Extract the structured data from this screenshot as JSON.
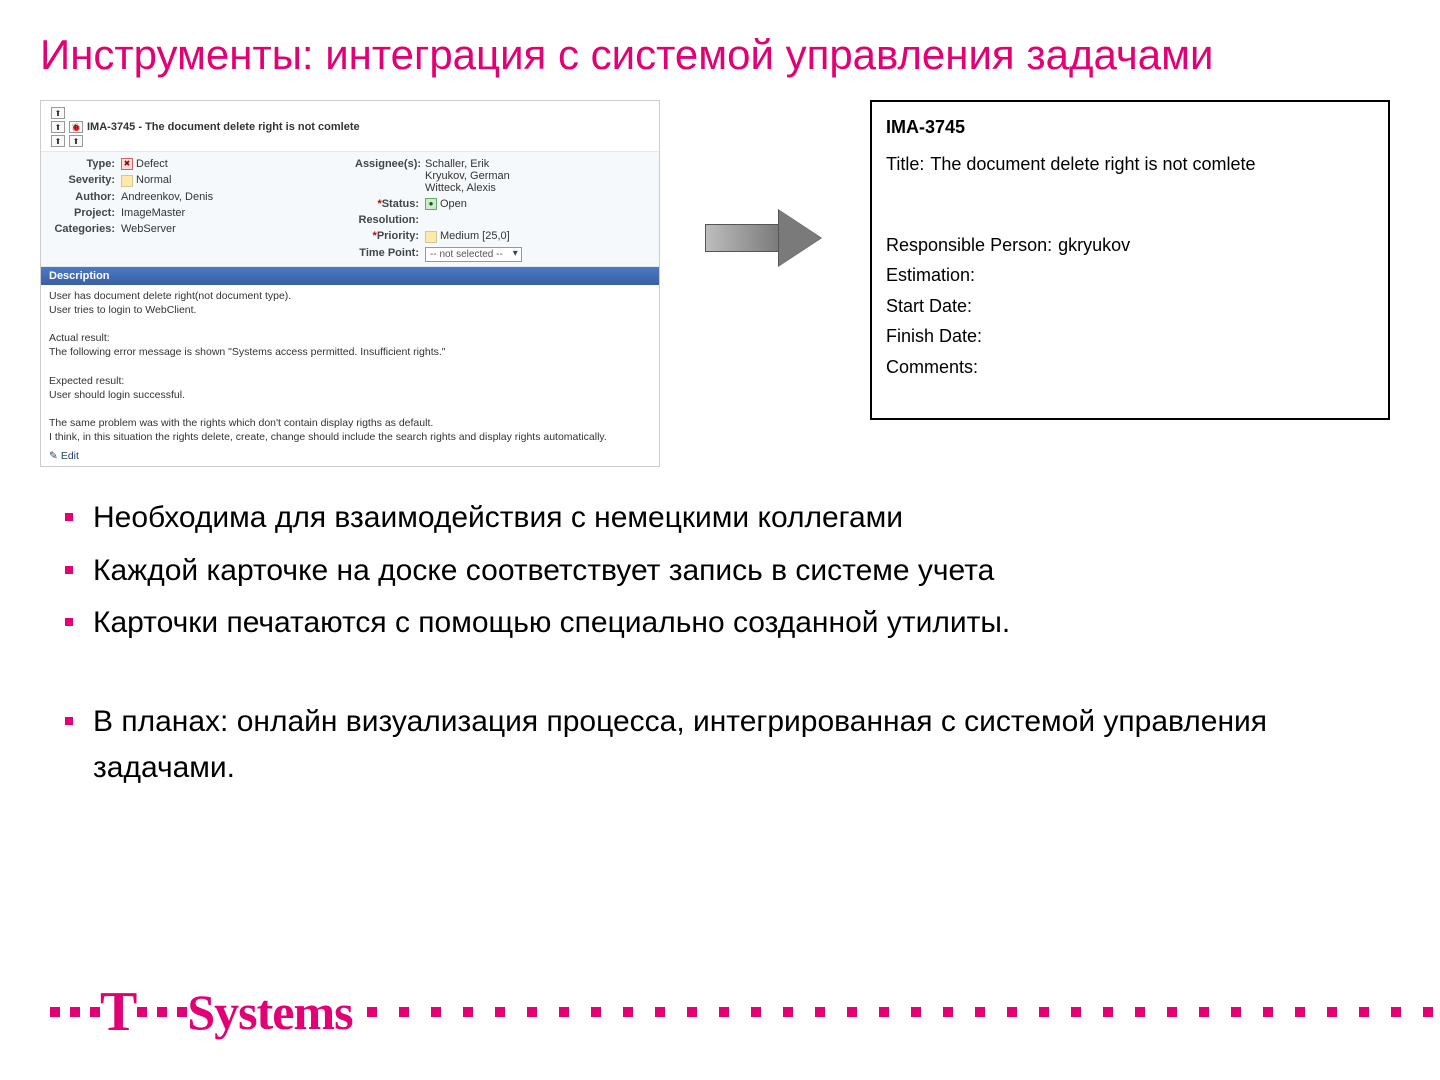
{
  "title": "Инструменты: интеграция с системой управления задачами",
  "tracker": {
    "crumb": "IMA-3745 - The document delete right is not comlete",
    "left": {
      "type_label": "Type:",
      "type_value": "Defect",
      "severity_label": "Severity:",
      "severity_value": "Normal",
      "author_label": "Author:",
      "author_value": "Andreenkov, Denis",
      "project_label": "Project:",
      "project_value": "ImageMaster",
      "categories_label": "Categories:",
      "categories_value": "WebServer"
    },
    "right": {
      "assignee_label": "Assignee(s):",
      "assignee_value": "Schaller, Erik\nKryukov, German\nWitteck, Alexis",
      "status_label": "Status:",
      "status_req": "*",
      "status_value": "Open",
      "resolution_label": "Resolution:",
      "resolution_value": "",
      "priority_label": "Priority:",
      "priority_req": "*",
      "priority_value": "Medium [25,0]",
      "timepoint_label": "Time Point:",
      "timepoint_value": "-- not selected --"
    },
    "description_header": "Description",
    "description_body": "User has document delete right(not document type).\nUser tries to login to WebClient.\n\nActual result:\nThe following error message is shown \"Systems access permitted. Insufficient rights.\"\n\nExpected result:\nUser should login successful.\n\nThe same problem was with the rights which don't contain display rigths as default.\nI think, in this situation the rights delete, create, change should include the search rights and display rights automatically.",
    "edit_label": "Edit"
  },
  "card": {
    "id": "IMA-3745",
    "title_label": "Title:",
    "title_value": "The document delete right is not comlete",
    "responsible_label": "Responsible Person:",
    "responsible_value": "gkryukov",
    "estimation_label": "Estimation:",
    "estimation_value": "",
    "start_label": "Start Date:",
    "start_value": "",
    "finish_label": "Finish Date:",
    "finish_value": "",
    "comments_label": "Comments:",
    "comments_value": ""
  },
  "bullets": {
    "b1": "Необходима для взаимодействия с немецкими коллегами",
    "b2": "Каждой карточке на доске соответствует запись в системе учета",
    "b3": "Карточки печатаются с помощью специально созданной утилиты.",
    "b4": "В планах: онлайн визуализация процесса, интегрированная с системой управления задачами."
  },
  "logo": {
    "t": "T",
    "systems": "Systems"
  }
}
